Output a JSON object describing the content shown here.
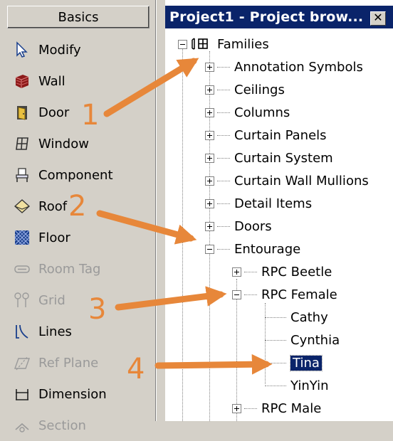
{
  "palette": {
    "title": "Basics",
    "items": [
      {
        "label": "Modify",
        "icon": "cursor-arrow-icon",
        "enabled": true
      },
      {
        "label": "Wall",
        "icon": "wall-icon",
        "enabled": true
      },
      {
        "label": "Door",
        "icon": "door-icon",
        "enabled": true
      },
      {
        "label": "Window",
        "icon": "window-icon",
        "enabled": true
      },
      {
        "label": "Component",
        "icon": "component-icon",
        "enabled": true
      },
      {
        "label": "Roof",
        "icon": "roof-icon",
        "enabled": true
      },
      {
        "label": "Floor",
        "icon": "floor-icon",
        "enabled": true
      },
      {
        "label": "Room Tag",
        "icon": "room-tag-icon",
        "enabled": false
      },
      {
        "label": "Grid",
        "icon": "grid-icon",
        "enabled": false
      },
      {
        "label": "Lines",
        "icon": "lines-icon",
        "enabled": true
      },
      {
        "label": "Ref Plane",
        "icon": "ref-plane-icon",
        "enabled": false
      },
      {
        "label": "Dimension",
        "icon": "dimension-icon",
        "enabled": true
      },
      {
        "label": "Section",
        "icon": "section-icon",
        "enabled": false
      }
    ]
  },
  "browser": {
    "title": "Project1 - Project brow...",
    "close_label": "✕",
    "tree": {
      "root": "Families",
      "categories": [
        "Annotation Symbols",
        "Ceilings",
        "Columns",
        "Curtain Panels",
        "Curtain System",
        "Curtain Wall Mullions",
        "Detail Items",
        "Doors"
      ],
      "expanded": "Entourage",
      "entourage_children": [
        "RPC Beetle",
        "RPC Female",
        "RPC Male"
      ],
      "female_children": [
        "Cathy",
        "Cynthia",
        "Tina",
        "YinYin"
      ],
      "selected": "Tina"
    }
  },
  "annotations": {
    "callouts": [
      "1",
      "2",
      "3",
      "4"
    ],
    "arrow_color": "#e7873a"
  },
  "colors": {
    "titlebar": "#0a246a",
    "face": "#d4d0c8"
  }
}
